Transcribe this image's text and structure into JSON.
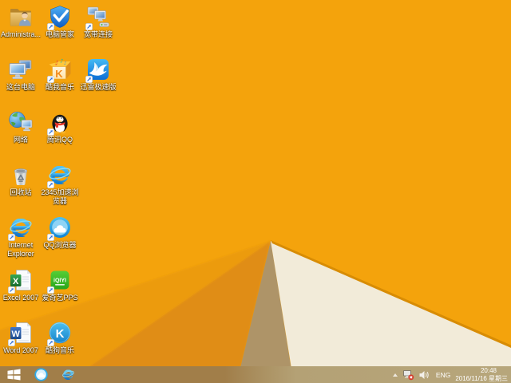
{
  "wallpaper": {
    "base": "#F4A30C",
    "facet_left": "#EC9B10",
    "facet_mid": "#E08D15",
    "facet_tan": "#AE9468",
    "facet_cream": "#F2EBD9",
    "seam": "#D88C04"
  },
  "desktop_icons": [
    {
      "label": "Administra...",
      "icon": "user-folder",
      "col": 0,
      "row": 0,
      "shortcut": false
    },
    {
      "label": "电脑管家",
      "icon": "pc-manager",
      "col": 1,
      "row": 0,
      "shortcut": true
    },
    {
      "label": "宽带连接",
      "icon": "broadband",
      "col": 2,
      "row": 0,
      "shortcut": true
    },
    {
      "label": "这台电脑",
      "icon": "this-pc",
      "col": 0,
      "row": 1,
      "shortcut": false
    },
    {
      "label": "酷我音乐",
      "icon": "kuwo-music",
      "col": 1,
      "row": 1,
      "shortcut": true
    },
    {
      "label": "迅雷极速版",
      "icon": "xunlei",
      "col": 2,
      "row": 1,
      "shortcut": true
    },
    {
      "label": "网络",
      "icon": "network",
      "col": 0,
      "row": 2,
      "shortcut": false
    },
    {
      "label": "腾讯QQ",
      "icon": "qq",
      "col": 1,
      "row": 2,
      "shortcut": true
    },
    {
      "label": "回收站",
      "icon": "recycle-bin",
      "col": 0,
      "row": 3,
      "shortcut": false
    },
    {
      "label": "2345加速浏\n览器",
      "icon": "browser-2345",
      "col": 1,
      "row": 3,
      "shortcut": true
    },
    {
      "label": "Internet\nExplorer",
      "icon": "ie",
      "col": 0,
      "row": 4,
      "shortcut": true
    },
    {
      "label": "QQ浏览器",
      "icon": "qq-browser",
      "col": 1,
      "row": 4,
      "shortcut": true
    },
    {
      "label": "Excel 2007",
      "icon": "excel-2007",
      "col": 0,
      "row": 5,
      "shortcut": true
    },
    {
      "label": "爱奇艺PPS",
      "icon": "iqiyi-pps",
      "col": 1,
      "row": 5,
      "shortcut": true
    },
    {
      "label": "Word 2007",
      "icon": "word-2007",
      "col": 0,
      "row": 6,
      "shortcut": true
    },
    {
      "label": "酷狗音乐",
      "icon": "kugou-music",
      "col": 1,
      "row": 6,
      "shortcut": true
    }
  ],
  "taskbar": {
    "apps": [
      {
        "name": "start",
        "icon": "windows-logo"
      },
      {
        "name": "qq-browser",
        "icon": "qq-browser-small"
      },
      {
        "name": "internet-explorer",
        "icon": "ie-small"
      }
    ],
    "tray": {
      "language": "ENG",
      "time": "20:48",
      "date": "2016/11/16 星期三"
    }
  }
}
